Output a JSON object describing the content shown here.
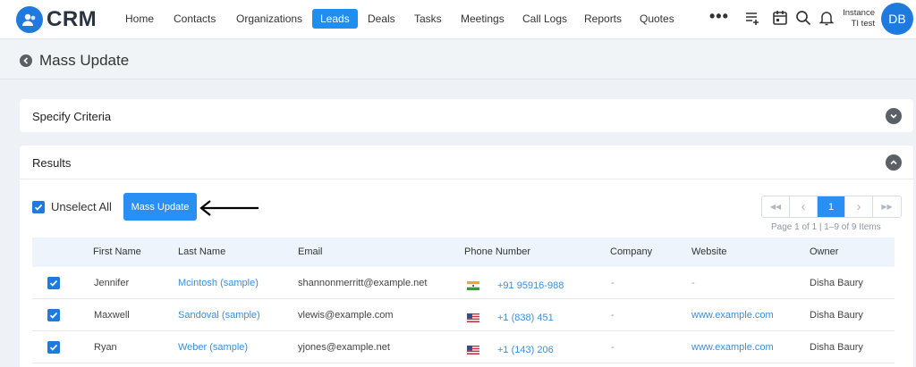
{
  "app": {
    "logo_text": "CRM"
  },
  "nav": {
    "items": [
      "Home",
      "Contacts",
      "Organizations",
      "Leads",
      "Deals",
      "Tasks",
      "Meetings",
      "Call Logs",
      "Reports",
      "Quotes"
    ],
    "active": "Leads",
    "more": "•••"
  },
  "user": {
    "instance_line1": "Instance",
    "instance_line2": "TI test",
    "initials": "DB"
  },
  "page": {
    "title": "Mass Update"
  },
  "criteria": {
    "title": "Specify Criteria"
  },
  "results": {
    "title": "Results",
    "unselect_label": "Unselect All",
    "mass_update_label": "Mass Update",
    "pagination": {
      "first": "◀◀",
      "prev": "‹",
      "current": "1",
      "next": "›",
      "last": "▶▶"
    },
    "page_info": "Page 1 of 1   |  1–9 of 9 Items",
    "columns": [
      "First Name",
      "Last Name",
      "Email",
      "Phone Number",
      "Company",
      "Website",
      "Owner"
    ],
    "rows": [
      {
        "first": "Jennifer",
        "last": "Mcintosh (sample)",
        "email": "shannonmerritt@example.net",
        "phone": "+91 95916-988",
        "flag": "india-flag-icon",
        "company": "-",
        "website": "-",
        "owner": "Disha Baury"
      },
      {
        "first": "Maxwell",
        "last": "Sandoval (sample)",
        "email": "vlewis@example.com",
        "phone": "+1 (838) 451",
        "flag": "us-flag-icon",
        "company": "-",
        "website": "www.example.com",
        "owner": "Disha Baury"
      },
      {
        "first": "Ryan",
        "last": "Weber (sample)",
        "email": "yjones@example.net",
        "phone": "+1 (143) 206",
        "flag": "us-flag-icon",
        "company": "-",
        "website": "www.example.com",
        "owner": "Disha Baury"
      }
    ]
  },
  "colors": {
    "brand": "#1f7ae0",
    "accent": "#2a8ff5",
    "link": "#3a8fd9"
  }
}
